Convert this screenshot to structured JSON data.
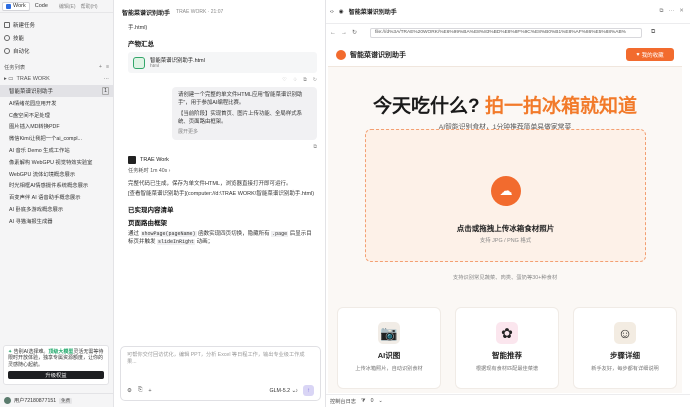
{
  "titlebar": {
    "tab_work": "Work",
    "tab_code": "Code",
    "menu_edit": "编辑(E)",
    "menu_help": "帮助(H)"
  },
  "nav": {
    "new_task": "新建任务",
    "skills": "技能",
    "automation": "自动化"
  },
  "tasks": {
    "header": "任务列表",
    "group": "TRAE WORK",
    "selected": "智能菜谱识别助手",
    "selected_count": "1",
    "items": [
      "AI情绪花园应用开发",
      "C盘空间不足处理",
      "图片插入MD转换PDF",
      "微信Kimi让我把一个ai_compl...",
      "AI 音乐 Demo 生成工作站",
      "像素解构 WebGPU 视觉特效实验室",
      "WebGPU 流体幻境概念展示",
      "时光相框AI情感摄件系统概念展示",
      "百变声伴 AI 语音助手概念展示",
      "AI 卧底多游戏概念展示",
      "AI 寻猫海报生成器"
    ]
  },
  "promo": {
    "text_lead": "告别AI选择难。",
    "text_highlight": "顶级大模型",
    "text_rest": "灵活无需等待 限时开放体验，独享专属资源额度，让你的灵感随心起航。",
    "button": "升级权益"
  },
  "user": {
    "name": "用户72180877151",
    "badge": "免费"
  },
  "chat": {
    "title": "智能菜谱识别助手",
    "subtitle": "TRAE WORK · 21:07",
    "line_top": "手.html)",
    "artifacts_heading": "产物汇总",
    "file_name": "智能菜谱识别助手.html",
    "file_type": "html",
    "user_message": "请创建一个完整的单文件HTML应用\"智能菜谱识别助手\"，用于参加AI编程比赛。",
    "user_message2": "【当前阶段】实现首页、图片上传功能、全局样式系统、页面路由框架。",
    "show_more": "展开更多",
    "assistant_name": "TRAE Work",
    "done_time": "任务耗时 1m 40s",
    "resp1": "完整代码已生成，保存为单文件HTML，浏览器直接打开即可运行。",
    "resp2": "[查看智能菜谱识别助手](computer://d:\\TRAE WORK\\智能菜谱识别助手.html)",
    "list_heading": "已实现内容清单",
    "route_heading": "页面路由框架",
    "route_prefix": "通过",
    "route_code1": "showPage(pageName)",
    "route_mid": "函数实现四页切换，隐藏所有",
    "route_code2": ".page",
    "route_tail": "后显示目标页并触发",
    "route_code3": "slideInRight",
    "route_end": "动画；",
    "input_placeholder": "可帮你交付回访优化，编辑 PPT，分析 Excel 等日程工作，输出专业级工作成果...",
    "model": "GLM-5.2",
    "send_icon": "arrow-up-icon"
  },
  "browser": {
    "title": "智能菜谱识别助手",
    "url": "file:///d%3A/TRAE%20WORK/%E6%99%BA%E8%83%BD%E8%8F%9C%E8%B0%B1%E8%AF%86%E5%88%AB%",
    "footer": "控制台日志",
    "footer_count": "0"
  },
  "app": {
    "brand": "智能菜谱识别助手",
    "fav_button": "我的收藏",
    "hero_main": "今天吃什么?",
    "hero_accent": "拍一拍冰箱就知道",
    "tagline": "AI智能识别食材，1分钟推荐简单易做家常菜",
    "upload_title": "点击或拖拽上传冰箱食材照片",
    "upload_sub": "支持 JPG / PNG 格式",
    "upload_tip": "支持识别常见蔬菜、肉类、蛋奶等30+种食材",
    "features": [
      {
        "title": "AI识图",
        "desc": "上传冰箱照片，自动识别食材",
        "icon": "camera-icon"
      },
      {
        "title": "智能推荐",
        "desc": "根据现有食材匹配最佳菜谱",
        "icon": "brain-icon"
      },
      {
        "title": "步骤详细",
        "desc": "新手友好，每步都有详细说明",
        "icon": "chef-icon"
      }
    ],
    "accent_color": "#f26b2e"
  }
}
